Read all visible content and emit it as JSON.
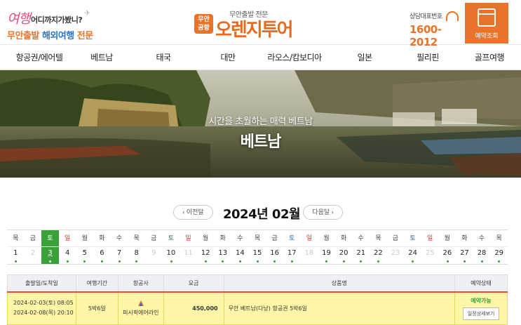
{
  "header": {
    "logo_left": {
      "script": "여행",
      "tag": "어디까지가봤니?",
      "bottom_1": "무안출발",
      "bottom_2": "해외여행",
      "bottom_3": "전문"
    },
    "logo_center": {
      "badge": "무안\n공항",
      "sub": "무안출발 전문",
      "main": "오렌지투어"
    },
    "contact": {
      "label": "상담대표번호",
      "number": "1600-2012"
    },
    "reservation_label": "예약조회"
  },
  "nav": {
    "items": [
      "항공권/에어텔",
      "베트남",
      "태국",
      "대만",
      "라오스/캄보디아",
      "일본",
      "필리핀",
      "골프여행"
    ]
  },
  "hero": {
    "subtitle": "시간을 초월하는 매력 베트남",
    "title": "베트남"
  },
  "month": {
    "prev": "이전달",
    "title": "2024년 02월",
    "next": "다음달"
  },
  "calendar": {
    "weekdays": [
      "목",
      "금",
      "토",
      "일",
      "월",
      "화",
      "수",
      "목",
      "금",
      "토",
      "일",
      "월",
      "화",
      "수",
      "목",
      "금",
      "토",
      "일",
      "월",
      "화",
      "수",
      "목",
      "금",
      "토",
      "일",
      "월",
      "화",
      "수",
      "목"
    ],
    "days": [
      "1",
      "2",
      "3",
      "4",
      "5",
      "6",
      "7",
      "8",
      "9",
      "10",
      "11",
      "12",
      "13",
      "14",
      "15",
      "16",
      "17",
      "18",
      "19",
      "20",
      "21",
      "22",
      "23",
      "24",
      "25",
      "26",
      "27",
      "28",
      "29"
    ],
    "selected": 2,
    "dim_days": [
      1,
      8,
      10,
      17,
      22,
      24
    ],
    "colors": {
      "sun": "#e0362e",
      "sat": "#2e63c5",
      "selected": "#3aa03a"
    }
  },
  "table": {
    "headers": [
      "출발일/도착일",
      "여행기간",
      "항공사",
      "요금",
      "상품명",
      "예약상태"
    ],
    "rows": [
      {
        "depart": "2024-02-03(토) 08:05",
        "arrive": "2024-02-08(목) 20:10",
        "duration": "5박6일",
        "airline": "퍼시픽에어라인",
        "price": "450,000",
        "product": "무안 베트남(다낭) 항공권 5박6일",
        "status": "예약가능",
        "detail": "일정상세보기"
      }
    ]
  },
  "colors": {
    "accent": "#e8732a",
    "green": "#3aa03a",
    "highlight": "#fff7a8"
  }
}
